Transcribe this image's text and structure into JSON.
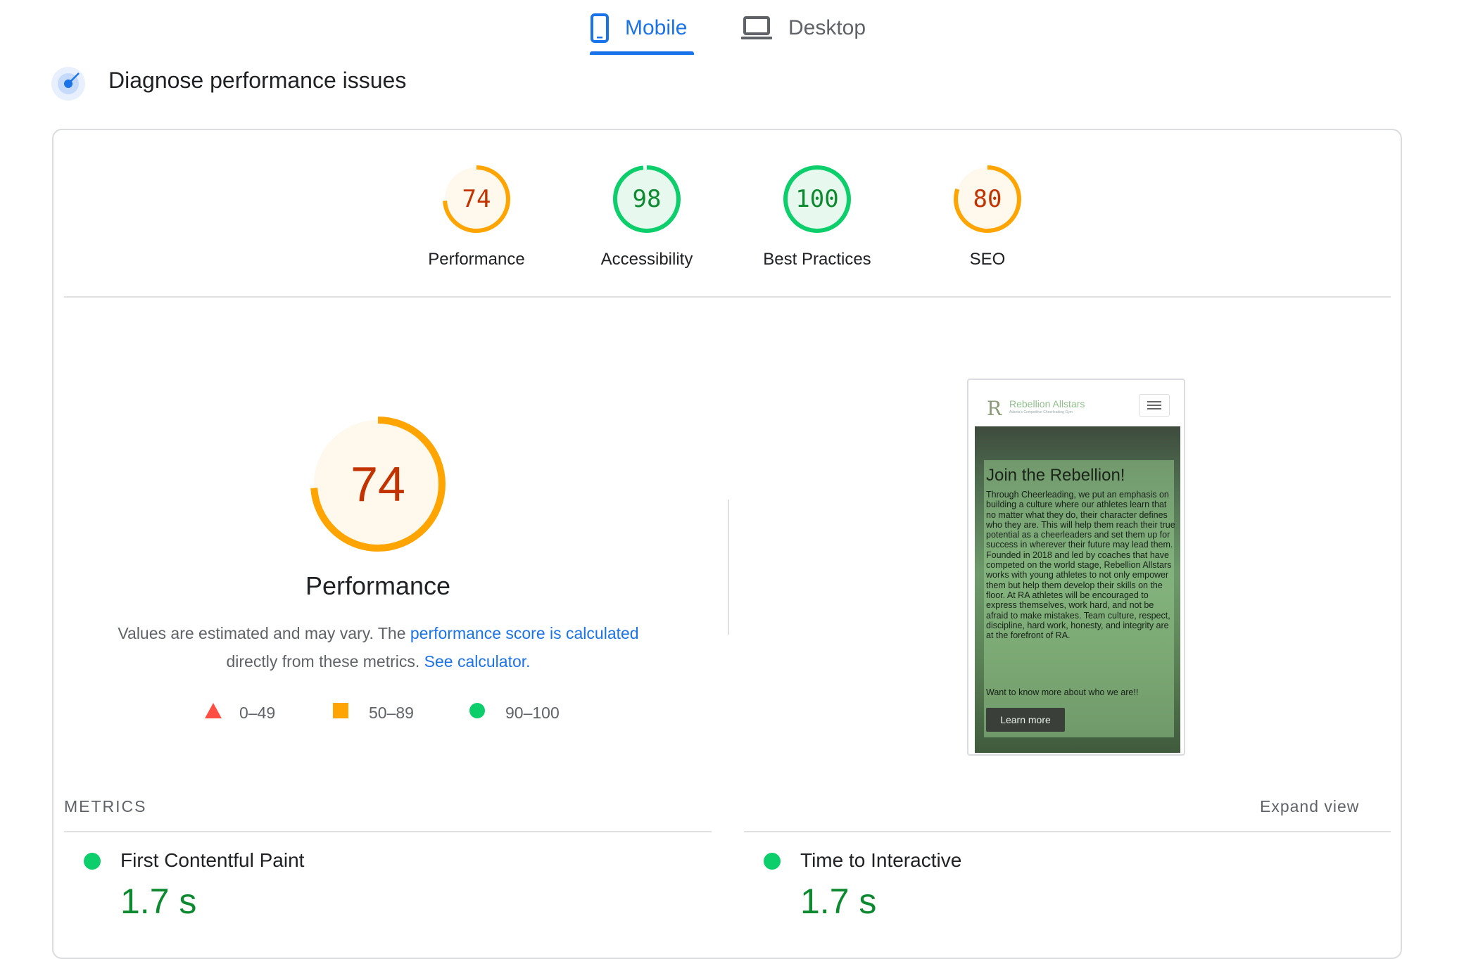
{
  "tabs": {
    "mobile_label": "Mobile",
    "desktop_label": "Desktop",
    "active": "Mobile",
    "active_color": "#1a73e8"
  },
  "section": {
    "title": "Diagnose performance issues"
  },
  "categories": [
    {
      "label": "Performance",
      "score": "74",
      "fraction": 0.74,
      "status": "average"
    },
    {
      "label": "Accessibility",
      "score": "98",
      "fraction": 0.98,
      "status": "pass"
    },
    {
      "label": "Best Practices",
      "score": "100",
      "fraction": 1.0,
      "status": "pass"
    },
    {
      "label": "SEO",
      "score": "80",
      "fraction": 0.8,
      "status": "average"
    }
  ],
  "colors": {
    "average_ring": "#ffa400",
    "average_text": "#c33300",
    "average_fill": "#fff8ec",
    "pass_ring": "#0cce6b",
    "pass_text": "#0d8a2f",
    "pass_fill": "#e7f8ee",
    "fail": "#ff4e42",
    "link": "#1a73e8"
  },
  "performance": {
    "score": "74",
    "fraction": 0.74,
    "title": "Performance",
    "desc_prefix": "Values are estimated and may vary. The ",
    "desc_link": "performance score is calculated",
    "desc_mid": " directly from these metrics. ",
    "desc_link2": "See calculator."
  },
  "legend": [
    {
      "icon": "triangle-icon",
      "range": "0–49"
    },
    {
      "icon": "square-icon",
      "range": "50–89"
    },
    {
      "icon": "circle-icon",
      "range": "90–100"
    }
  ],
  "screenshot": {
    "logo_letter": "R",
    "brand": "Rebellion Allstars",
    "brand_sub": "Atlanta's Competitive Cheerleading Gym",
    "heading": "Join the Rebellion!",
    "body": "Through Cheerleading, we put an emphasis on building a culture where our athletes learn that no matter what they do, their character defines who they are. This will help them reach their true potential as a cheerleaders and set them up for success in wherever their future may lead them. Founded in 2018 and led by coaches that have competed on the world stage, Rebellion Allstars works with young athletes to not only empower them but help them develop their skills on the floor. At RA athletes will be encouraged to express themselves, work hard, and not be afraid to make mistakes. Team culture, respect, discipline, hard work, honesty, and integrity are at the forefront of RA.",
    "question": "Want to know more about who we are!!",
    "button": "Learn more"
  },
  "metrics": {
    "label": "METRICS",
    "expand": "Expand view",
    "items": [
      {
        "name": "First Contentful Paint",
        "value": "1.7 s"
      },
      {
        "name": "Time to Interactive",
        "value": "1.7 s"
      }
    ]
  }
}
